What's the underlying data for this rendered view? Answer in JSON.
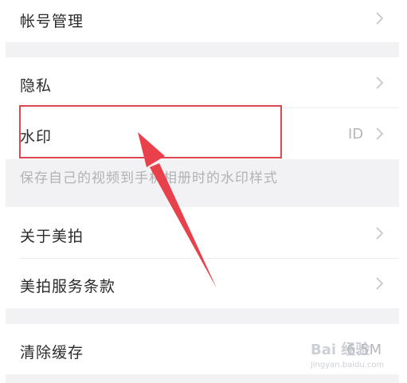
{
  "settings": {
    "account": {
      "label": "帐号管理"
    },
    "privacy": {
      "label": "隐私"
    },
    "watermark": {
      "label": "水印",
      "value": "ID"
    },
    "watermark_desc": "保存自己的视频到手机相册时的水印样式",
    "about": {
      "label": "关于美拍"
    },
    "terms": {
      "label": "美拍服务条款"
    },
    "cache": {
      "label": "清除缓存",
      "value": "6.5M"
    }
  },
  "annotation": {
    "highlight_color": "#e0454f",
    "arrow_color": "#e8414b"
  },
  "watermark_overlay": {
    "brand": "Bai 经验",
    "url": "jingyan.baidu.com"
  },
  "icons": [
    "chevron-right-icon"
  ]
}
